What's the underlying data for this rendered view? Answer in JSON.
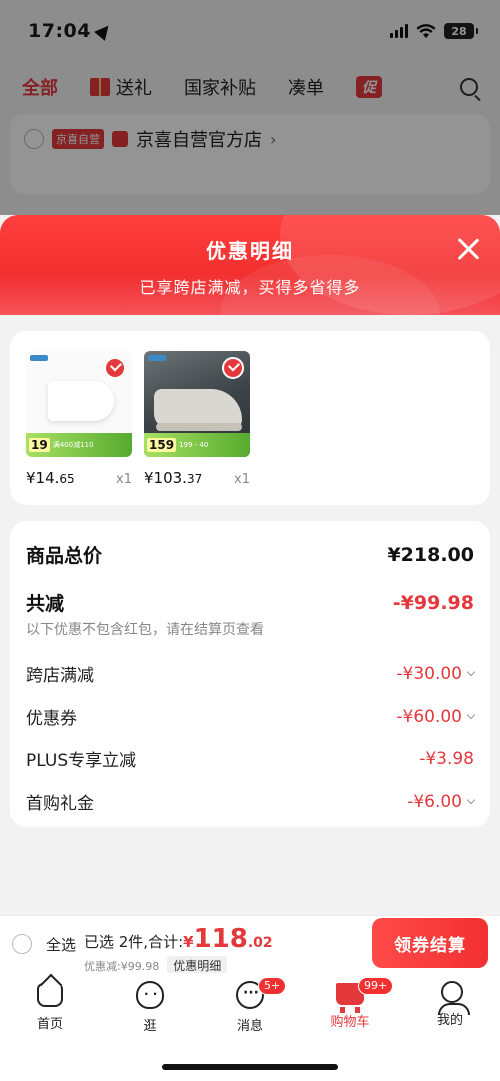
{
  "status": {
    "time": "17:04",
    "battery": "28"
  },
  "background": {
    "tabs": [
      "全部",
      "送礼",
      "国家补贴",
      "凑单",
      "促"
    ],
    "shop": {
      "tag": "京喜自营",
      "name": "京喜自营官方店",
      "chevron": "›"
    }
  },
  "sheet": {
    "title": "优惠明细",
    "subtitle": "已享跨店满减，买得多省得多",
    "products": [
      {
        "price_main": "¥14.",
        "price_decimal": "65",
        "qty": "x1",
        "tag_price": "19",
        "tag_text": "满400减110"
      },
      {
        "price_main": "¥103.",
        "price_decimal": "37",
        "qty": "x1",
        "tag_price": "159",
        "tag_text": "199 - 40"
      }
    ],
    "details": {
      "total_label": "商品总价",
      "total_value": "¥218.00",
      "reduce_label": "共减",
      "reduce_value": "-¥99.98",
      "note": "以下优惠不包含红包，请在结算页查看",
      "items": [
        {
          "label": "跨店满减",
          "value": "-¥30.00"
        },
        {
          "label": "优惠券",
          "value": "-¥60.00"
        },
        {
          "label": "PLUS专享立减",
          "value": "-¥3.98"
        },
        {
          "label": "首购礼金",
          "value": "-¥6.00"
        }
      ]
    }
  },
  "checkout": {
    "select_all": "全选",
    "summary_prefix": "已选 2件,合计:",
    "currency": "¥",
    "total_int": "118",
    "total_dec": ".02",
    "discount": "优惠减:¥99.98",
    "detail_btn": "优惠明细",
    "checkout_btn": "领券结算"
  },
  "tabbar": {
    "items": [
      {
        "label": "首页",
        "badge": ""
      },
      {
        "label": "逛",
        "badge": ""
      },
      {
        "label": "消息",
        "badge": "5+"
      },
      {
        "label": "购物车",
        "badge": "99+"
      },
      {
        "label": "我的",
        "badge": ""
      }
    ]
  },
  "colors": {
    "accent": "#e4393c",
    "header": "#f23030"
  }
}
